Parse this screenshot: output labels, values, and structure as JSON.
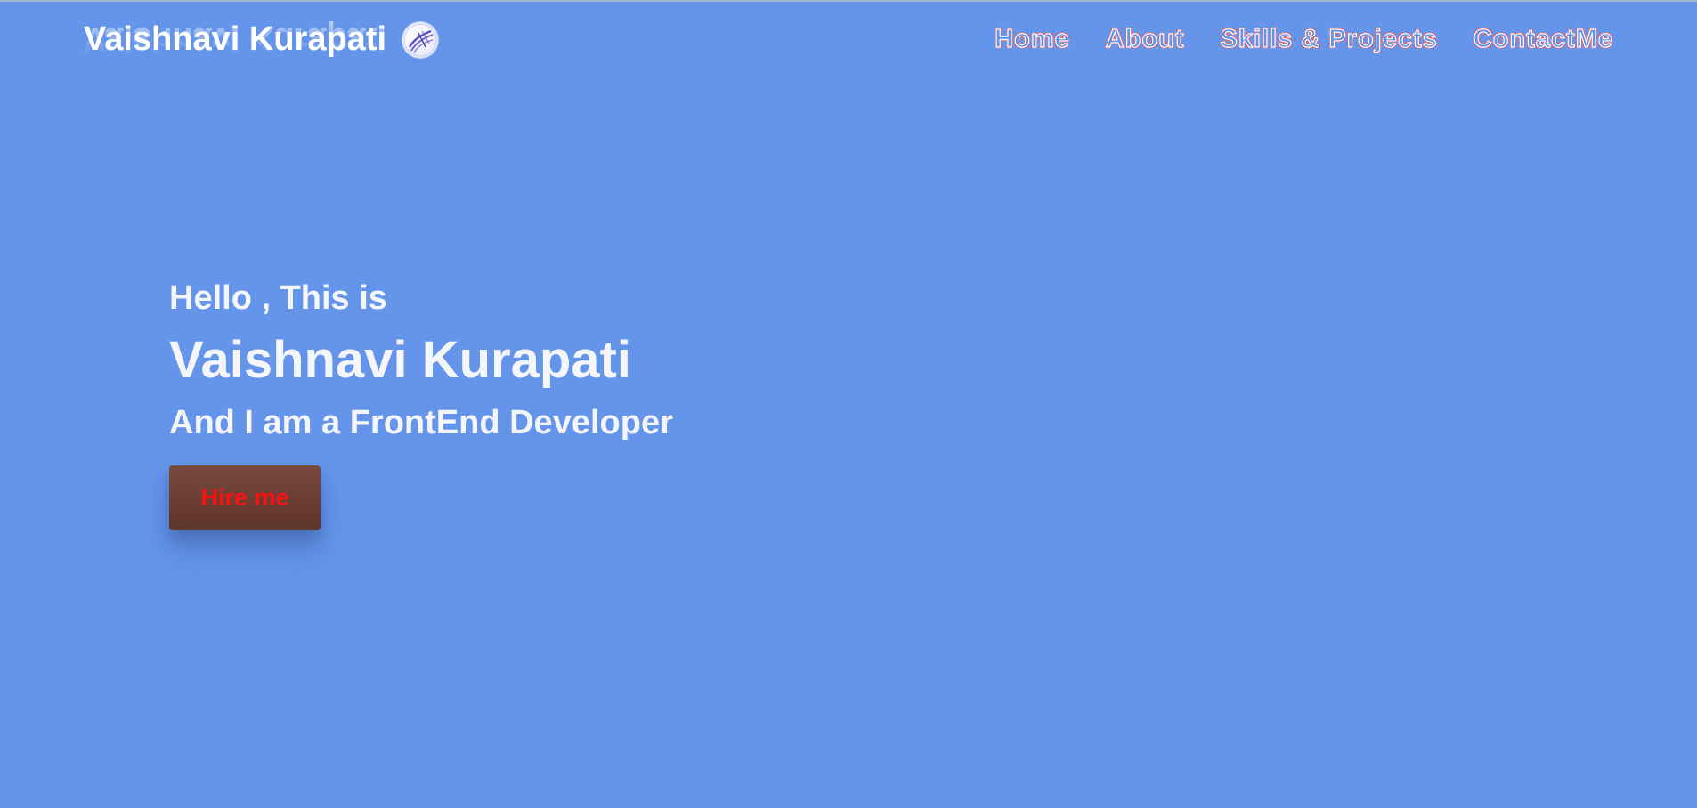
{
  "brand": {
    "name": "Vaishnavi Kurapati",
    "logo_icon": "globe-logo-icon"
  },
  "nav": {
    "items": [
      {
        "label": "Home"
      },
      {
        "label": "About"
      },
      {
        "label": "Skills & Projects"
      },
      {
        "label": "ContactMe"
      }
    ]
  },
  "hero": {
    "greeting": "Hello , This is",
    "name": "Vaishnavi Kurapati",
    "role": "And I am a FrontEnd Developer",
    "cta_label": "Hire me"
  },
  "colors": {
    "background": "#6495ea",
    "nav_outline": "#ff3b30",
    "cta_background": "#6a3c32",
    "cta_text": "#ff1010",
    "text": "#f4f6fb"
  }
}
